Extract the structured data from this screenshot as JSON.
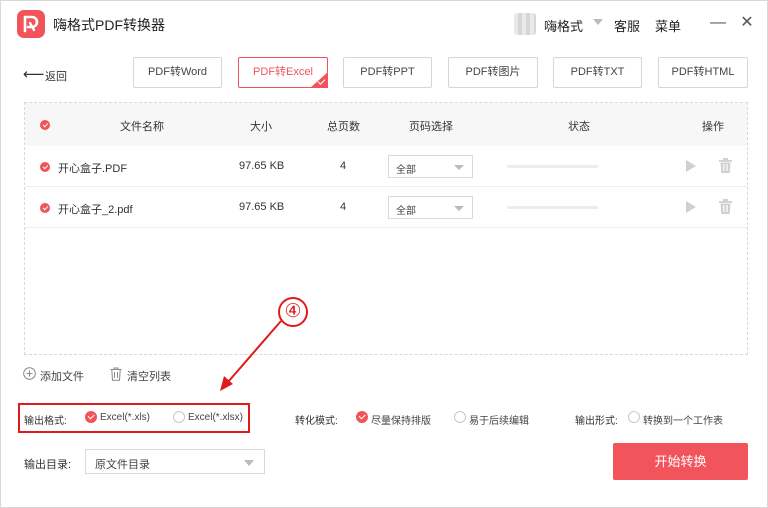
{
  "app": {
    "title": "嗨格式PDF转换器",
    "logo_icon": "pdf-logo-icon",
    "brand_color": "#f2545b"
  },
  "titlebar": {
    "user_name": "嗨格式",
    "service_label": "客服",
    "menu_label": "菜单",
    "minimize": "—",
    "close": "✕"
  },
  "nav": {
    "back_label": "返回",
    "tabs": [
      {
        "label": "PDF转Word",
        "active": false
      },
      {
        "label": "PDF转Excel",
        "active": true
      },
      {
        "label": "PDF转PPT",
        "active": false
      },
      {
        "label": "PDF转图片",
        "active": false
      },
      {
        "label": "PDF转TXT",
        "active": false
      },
      {
        "label": "PDF转HTML",
        "active": false
      }
    ]
  },
  "table": {
    "headers": {
      "name": "文件名称",
      "size": "大小",
      "pages": "总页数",
      "page_select": "页码选择",
      "status": "状态",
      "actions": "操作"
    },
    "rows": [
      {
        "name": "开心盒子.PDF",
        "size": "97.65 KB",
        "pages": "4",
        "page_select": "全部",
        "progress": 0
      },
      {
        "name": "开心盒子_2.pdf",
        "size": "97.65 KB",
        "pages": "4",
        "page_select": "全部",
        "progress": 0
      }
    ]
  },
  "actions": {
    "add_file": "添加文件",
    "clear_list": "清空列表"
  },
  "output": {
    "format_label": "输出格式:",
    "format_options": [
      "Excel(*.xls)",
      "Excel(*.xlsx)"
    ],
    "format_selected": 0,
    "mode_label": "转化模式:",
    "mode_options": [
      "尽量保持排版",
      "易于后续编辑"
    ],
    "mode_selected": 0,
    "form_label": "输出形式:",
    "form_options": [
      "转换到一个工作表"
    ],
    "form_selected": -1,
    "dir_label": "输出目录:",
    "dir_value": "原文件目录"
  },
  "annotation": {
    "step_badge": "④",
    "highlight_color": "#e01b1b"
  },
  "start_button": "开始转换"
}
